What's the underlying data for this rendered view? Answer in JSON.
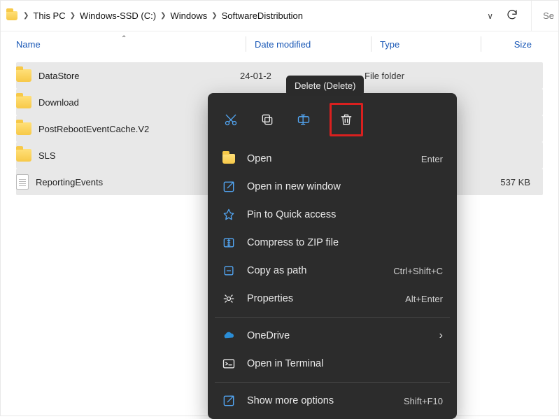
{
  "toolbar": {
    "breadcrumb": [
      "This PC",
      "Windows-SSD (C:)",
      "Windows",
      "SoftwareDistribution"
    ],
    "search_placeholder": "Se"
  },
  "columns": {
    "name": "Name",
    "date": "Date modified",
    "type": "Type",
    "size": "Size"
  },
  "rows": [
    {
      "name": "DataStore",
      "date": "24-01-2",
      "type": "File folder",
      "size": "",
      "icon": "folder",
      "selected": true
    },
    {
      "name": "Download",
      "date": "",
      "type": "",
      "size": "",
      "icon": "folder",
      "selected": true
    },
    {
      "name": "PostRebootEventCache.V2",
      "date": "",
      "type": "",
      "size": "",
      "icon": "folder",
      "selected": true
    },
    {
      "name": "SLS",
      "date": "",
      "type": "",
      "size": "",
      "icon": "folder",
      "selected": true
    },
    {
      "name": "ReportingEvents",
      "date": "",
      "type": "",
      "size": "537 KB",
      "icon": "txt",
      "selected": true
    }
  ],
  "tooltip": {
    "text": "Delete (Delete)"
  },
  "context_menu": {
    "top_icons": [
      "cut",
      "copy",
      "rename",
      "delete"
    ],
    "items": [
      {
        "icon": "folder",
        "label": "Open",
        "accel": "Enter"
      },
      {
        "icon": "open-new",
        "label": "Open in new window",
        "accel": ""
      },
      {
        "icon": "pin",
        "label": "Pin to Quick access",
        "accel": ""
      },
      {
        "icon": "zip",
        "label": "Compress to ZIP file",
        "accel": ""
      },
      {
        "icon": "copypath",
        "label": "Copy as path",
        "accel": "Ctrl+Shift+C"
      },
      {
        "icon": "props",
        "label": "Properties",
        "accel": "Alt+Enter"
      }
    ],
    "items2": [
      {
        "icon": "onedrive",
        "label": "OneDrive",
        "accel": "",
        "right_chevron": true
      },
      {
        "icon": "terminal",
        "label": "Open in Terminal",
        "accel": ""
      }
    ],
    "items3": [
      {
        "icon": "more",
        "label": "Show more options",
        "accel": "Shift+F10"
      }
    ]
  }
}
